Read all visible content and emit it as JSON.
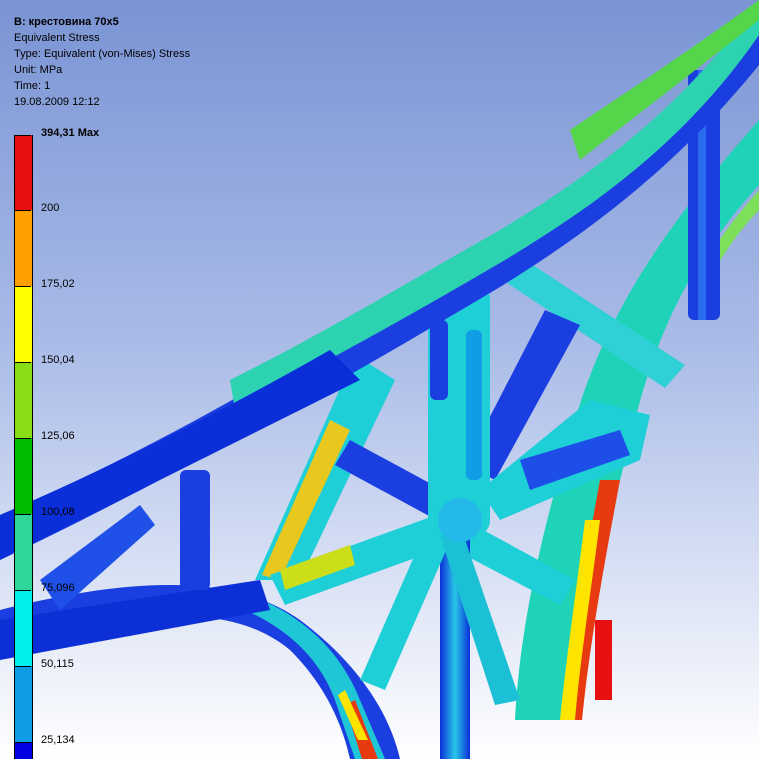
{
  "result": {
    "title": "B: крестовина 70х5",
    "result_name": "Equivalent Stress",
    "type_line": "Type: Equivalent (von-Mises) Stress",
    "unit_line": "Unit: MPa",
    "time_line": "Time: 1",
    "timestamp": "19.08.2009 12:12"
  },
  "legend": {
    "labels": [
      "394,31 Max",
      "200",
      "175,02",
      "150,04",
      "125,06",
      "100,08",
      "75,096",
      "50,115",
      "25,134"
    ],
    "colors": [
      "#e81010",
      "#ff9f00",
      "#ffff00",
      "#88dd14",
      "#00bb00",
      "#2fd79a",
      "#00f0ee",
      "#0f9de6",
      "#0000e0"
    ]
  }
}
